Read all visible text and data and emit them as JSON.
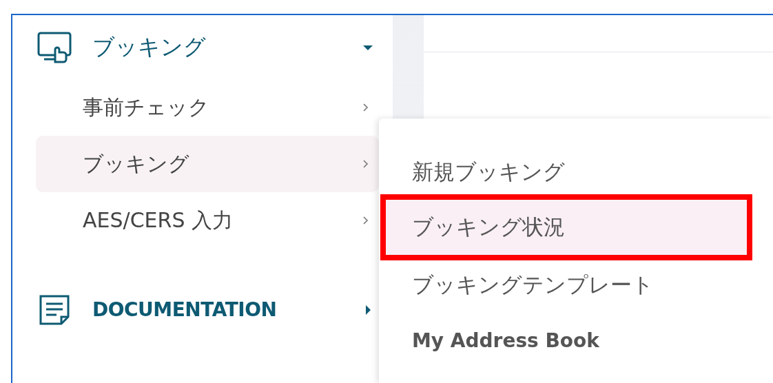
{
  "sidebar": {
    "groups": [
      {
        "label": "ブッキング",
        "kind": "booking",
        "expanded": true,
        "items": [
          {
            "label": "事前チェック",
            "selected": false
          },
          {
            "label": "ブッキング",
            "selected": true
          },
          {
            "label": "AES/CERS 入力",
            "selected": false
          }
        ]
      },
      {
        "label": "DOCUMENTATION",
        "kind": "document",
        "expanded": false
      }
    ]
  },
  "submenu": {
    "items": [
      {
        "label": "新規ブッキング",
        "selected": false,
        "callout": false
      },
      {
        "label": "ブッキング状況",
        "selected": true,
        "callout": true
      },
      {
        "label": "ブッキングテンプレート",
        "selected": false,
        "callout": false
      },
      {
        "label": "My Address Book",
        "selected": false,
        "callout": false
      }
    ]
  }
}
